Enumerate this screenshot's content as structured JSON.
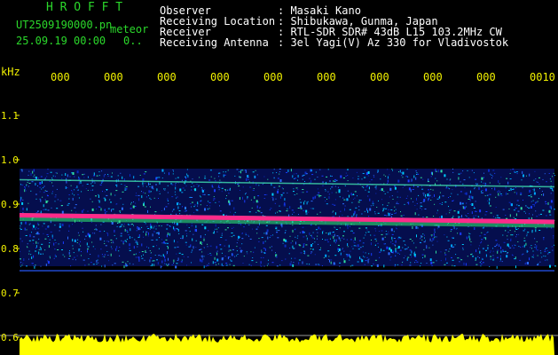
{
  "header": {
    "logo": "H R O F F T",
    "filename": "UT2509190000.pn",
    "mode": "meteor",
    "datetime": "25.09.19 00:00",
    "count": "0..",
    "fields": [
      {
        "label": "Observer",
        "value": ": Masaki Kano"
      },
      {
        "label": "Receiving Location",
        "value": ": Shibukawa, Gunma, Japan"
      },
      {
        "label": "Receiver",
        "value": ": RTL-SDR SDR# 43dB L15 103.2MHz CW"
      },
      {
        "label": "Receiving Antenna",
        "value": ": 3el Yagi(V) Az 330 for Vladivostok"
      }
    ]
  },
  "chart_data": {
    "type": "heatmap",
    "ylabel": "kHz",
    "ylim": [
      0.6,
      1.1
    ],
    "y_ticks": [
      "1.1",
      "1.0",
      "0.9",
      "0.8",
      "0.7",
      "0.6"
    ],
    "x_ticks": [
      "000",
      "000",
      "000",
      "000",
      "000",
      "000",
      "000",
      "000",
      "000",
      "0010"
    ],
    "signal_band": {
      "start_khz": 0.875,
      "end_khz": 0.86
    },
    "noise_band_khz": [
      0.76,
      0.98
    ],
    "lines_khz": [
      0.955,
      0.75
    ],
    "amplitude_strip": "yellow",
    "colors": {
      "background": "#000000",
      "signal": "#ff2a8a",
      "noise": "#1a4cff",
      "amplitude": "#ffff00",
      "tick": "#f2f200"
    }
  }
}
